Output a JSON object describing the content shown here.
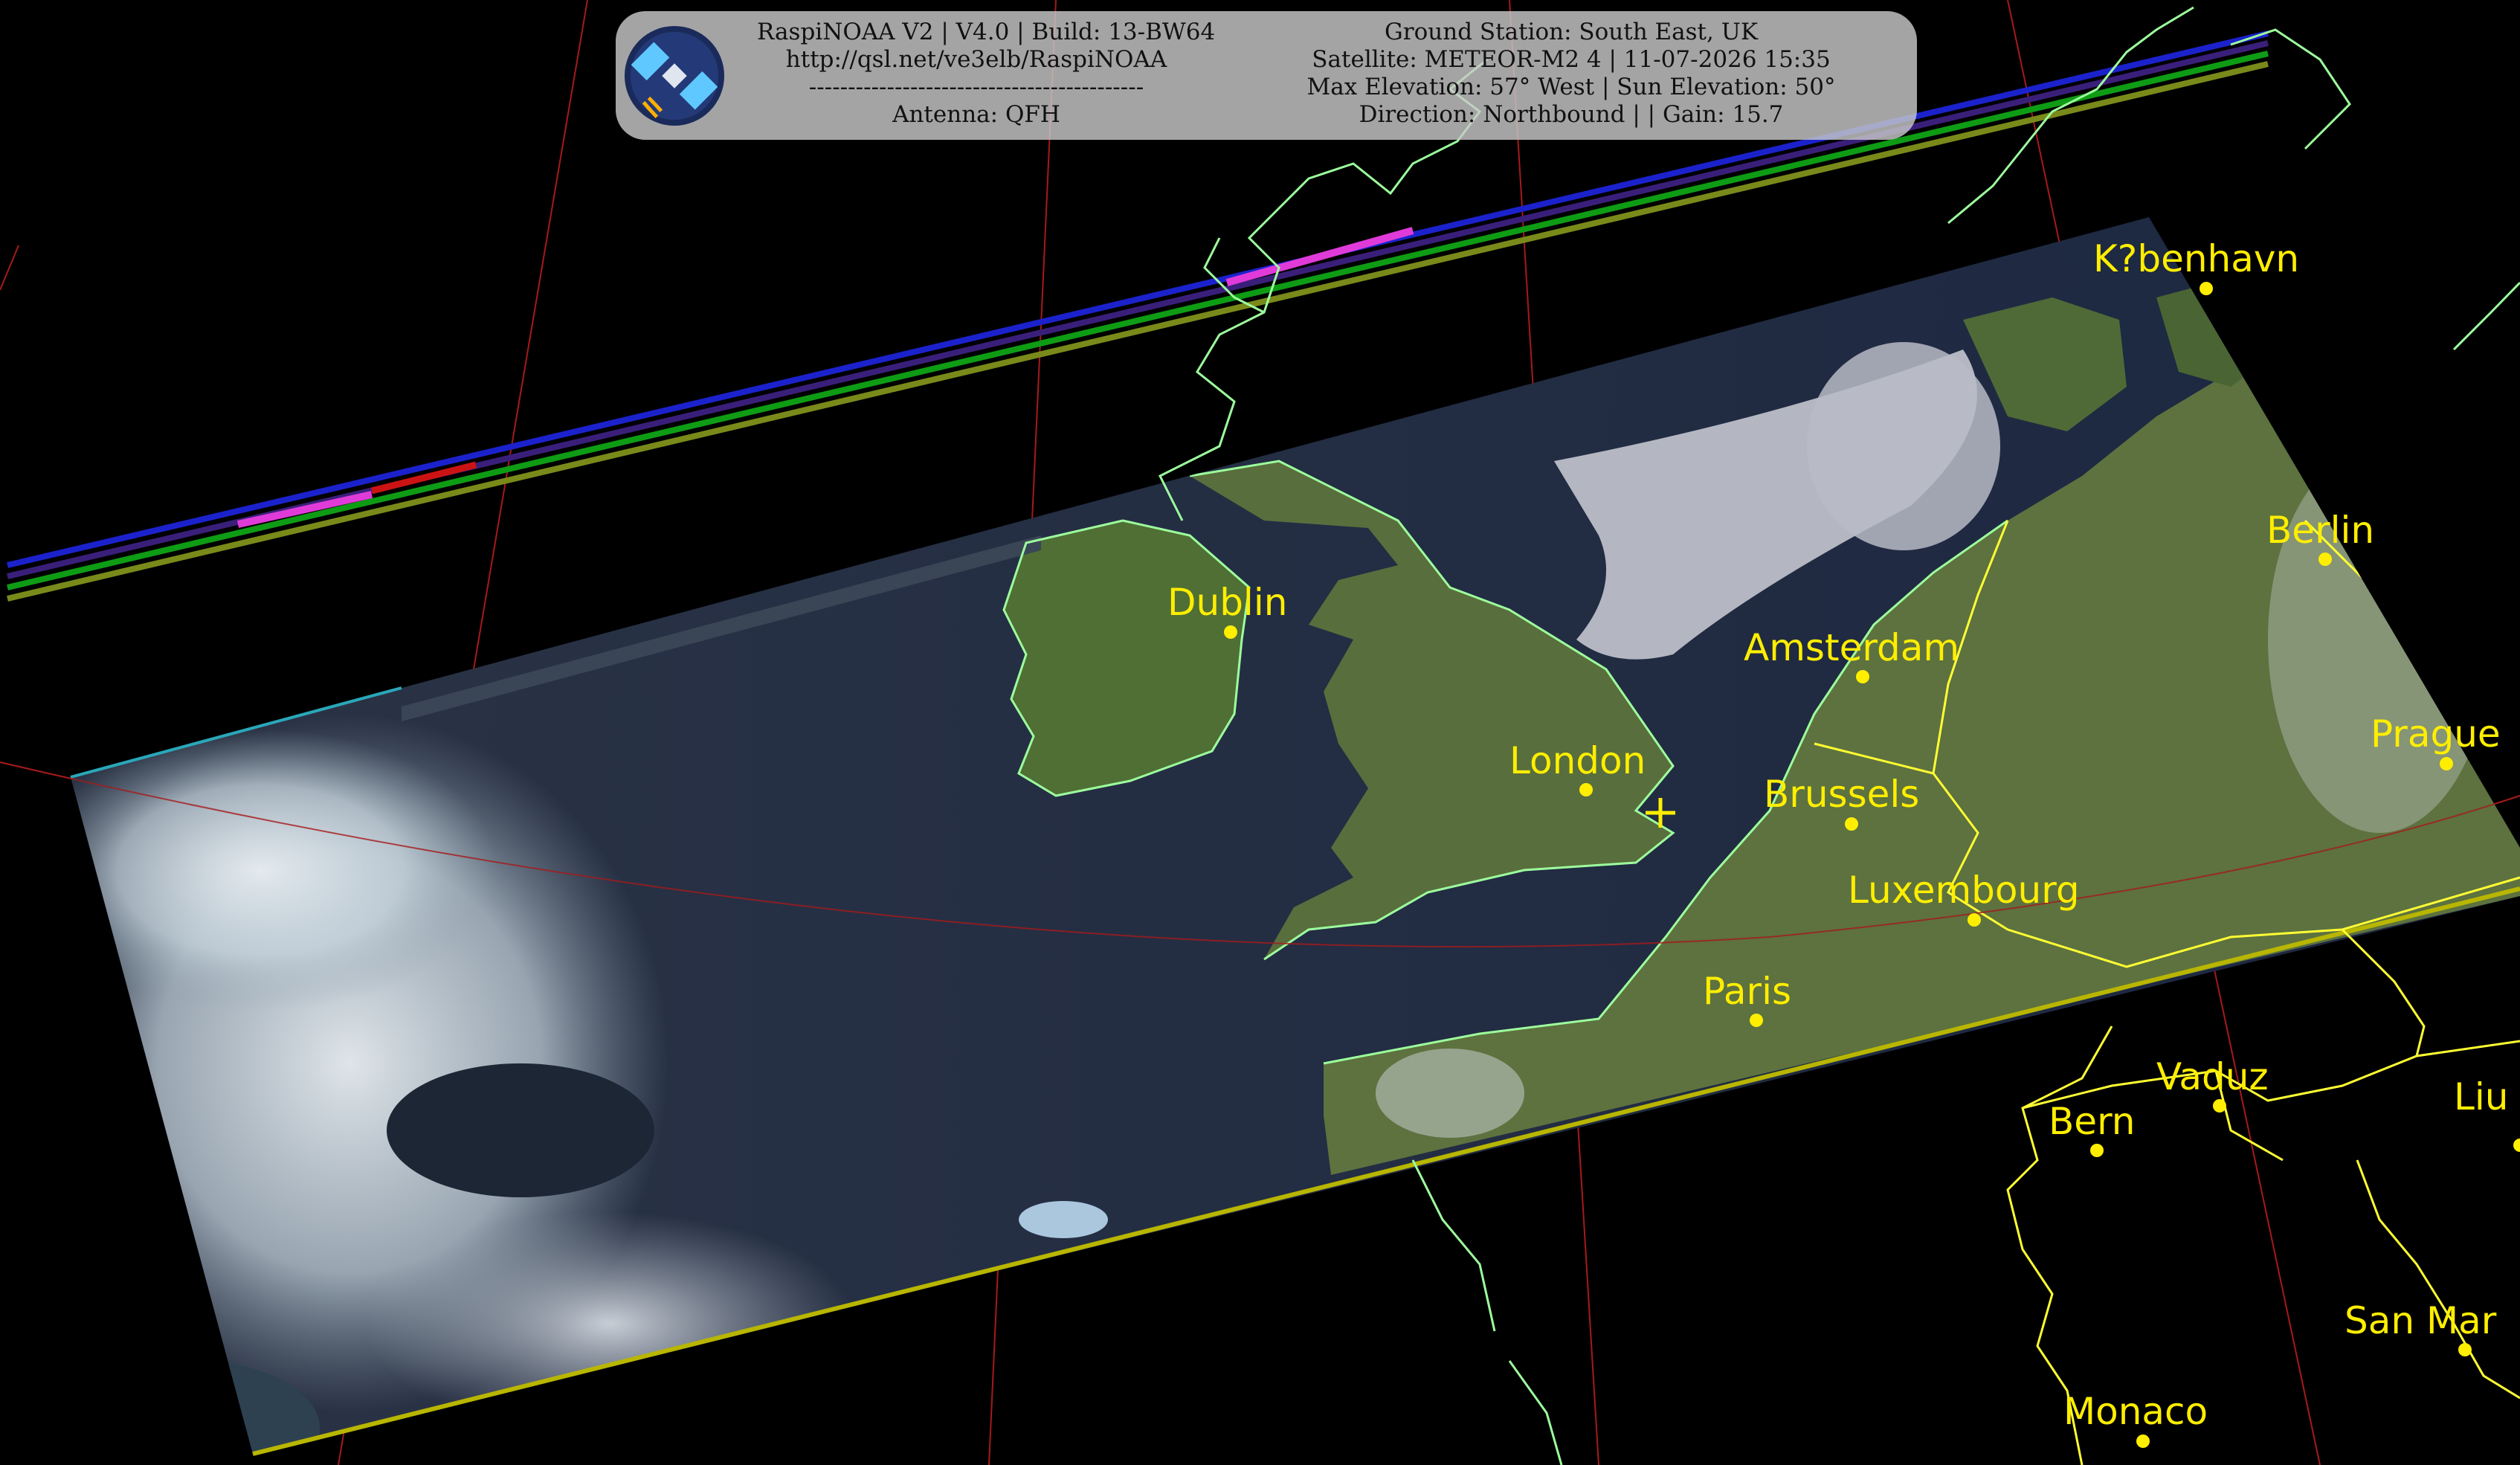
{
  "header": {
    "left_lines": [
      "RaspiNOAA V2 | V4.0 | Build: 13-BW64",
      "http://qsl.net/ve3elb/RaspiNOAA",
      "-------------------------------------------",
      "Antenna: QFH"
    ],
    "right_lines": [
      "Ground Station: South East, UK",
      "Satellite: METEOR-M2 4 | 11-07-2026 15:35",
      "Max Elevation: 57° West | Sun Elevation: 50°",
      "Direction: Northbound | | Gain: 15.7"
    ],
    "logo_icon": "satellite-logo-icon"
  },
  "cities": [
    {
      "name": "K?benhavn"
    },
    {
      "name": "Berlin"
    },
    {
      "name": "Dublin"
    },
    {
      "name": "Amsterdam"
    },
    {
      "name": "London"
    },
    {
      "name": "Brussels"
    },
    {
      "name": "Prague"
    },
    {
      "name": "Luxembourg"
    },
    {
      "name": "Paris"
    },
    {
      "name": "Vaduz"
    },
    {
      "name": "Bern"
    },
    {
      "name": "Liu"
    },
    {
      "name": "San Mar"
    },
    {
      "name": "Monaco"
    }
  ],
  "colors": {
    "coastline": "#9dff9d",
    "borders": "#ffff33",
    "city_labels": "#ffee00",
    "graticule": "#b02020"
  }
}
